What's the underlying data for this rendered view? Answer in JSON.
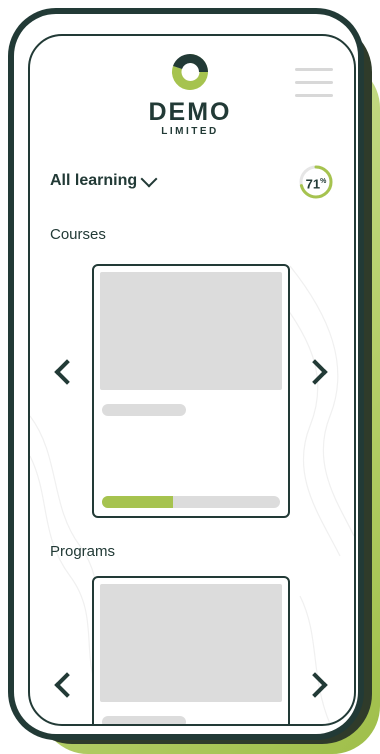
{
  "header": {
    "brand_main": "DEMO",
    "brand_sub": "LIMITED",
    "icons": [
      "logo-mark",
      "hamburger-menu-icon"
    ]
  },
  "filter": {
    "label": "All learning"
  },
  "progress": {
    "value": 71,
    "label": "71"
  },
  "sections": [
    {
      "title": "Courses",
      "card_progress": 0.4
    },
    {
      "title": "Programs"
    }
  ],
  "colors": {
    "dark": "#223a36",
    "accent": "#a6c34f",
    "placeholder": "#dcdcdc"
  }
}
